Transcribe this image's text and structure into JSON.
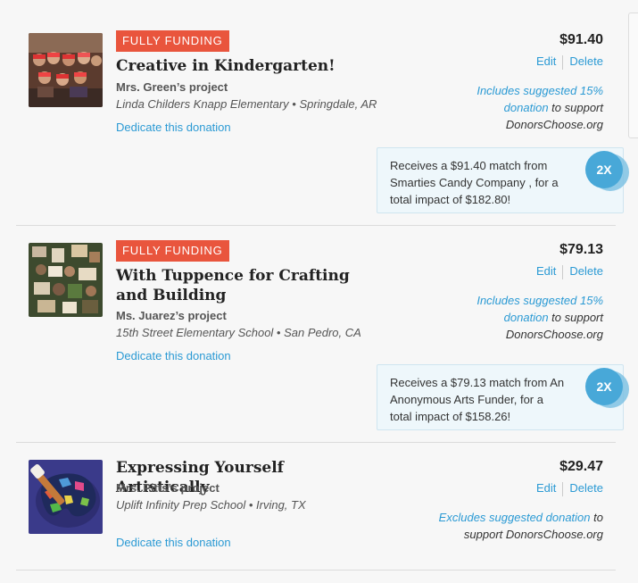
{
  "colors": {
    "accent": "#2b9ad4",
    "badge": "#e9553d",
    "match_bg": "#eef7fb"
  },
  "items": [
    {
      "badge": "FULLY FUNDING",
      "title": "Creative in Kindergarten!",
      "teacher": "Mrs. Green’s project",
      "school": "Linda Childers Knapp Elementary • Springdale, AR",
      "dedicate": "Dedicate this donation",
      "price": "$91.40",
      "edit": "Edit",
      "delete": "Delete",
      "note_link": "Includes suggested 15% donation",
      "note_rest": " to support DonorsChoose.org",
      "match": "Receives a $91.40 match from Smarties Candy Company , for a total impact of $182.80!",
      "match_badge": "2X",
      "thumb_icon": "classroom-photo-icon"
    },
    {
      "badge": "FULLY FUNDING",
      "title": "With Tuppence for Crafting and Building",
      "teacher": "Ms. Juarez’s project",
      "school": "15th Street Elementary School • San Pedro, CA",
      "dedicate": "Dedicate this donation",
      "price": "$79.13",
      "edit": "Edit",
      "delete": "Delete",
      "note_link": "Includes suggested 15% donation",
      "note_rest": " to support DonorsChoose.org",
      "match": "Receives a $79.13 match from An Anonymous Arts Funder, for a total impact of $158.26!",
      "match_badge": "2X",
      "thumb_icon": "classroom-photo-icon"
    },
    {
      "title": "Expressing Yourself Artistically",
      "teacher": "Mrs. Pitts’s project",
      "school": "Uplift Infinity Prep School • Irving, TX",
      "dedicate": "Dedicate this donation",
      "price": "$29.47",
      "edit": "Edit",
      "delete": "Delete",
      "note_link": "Excludes suggested donation",
      "note_rest": " to support DonorsChoose.org",
      "thumb_icon": "paint-palette-icon"
    }
  ]
}
